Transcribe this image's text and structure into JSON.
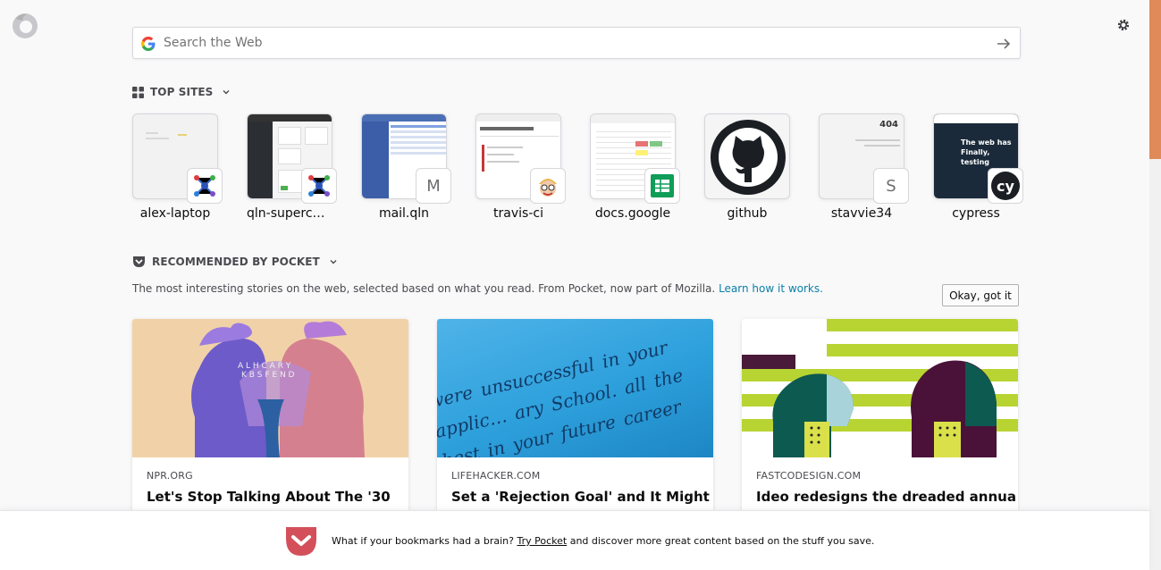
{
  "search": {
    "placeholder": "Search the Web"
  },
  "top_sites": {
    "title": "TOP SITES",
    "tiles": [
      {
        "label": "alex-laptop",
        "badge": "",
        "icon": "network-graph-icon"
      },
      {
        "label": "qln-superca…",
        "badge": "",
        "icon": "network-graph-icon"
      },
      {
        "label": "mail.qln",
        "badge": "M",
        "icon": "letter-m-icon"
      },
      {
        "label": "travis-ci",
        "badge": "",
        "icon": "travis-mascot-icon"
      },
      {
        "label": "docs.google",
        "badge": "",
        "icon": "google-sheets-icon"
      },
      {
        "label": "github",
        "badge": "",
        "icon": "github-octocat-icon"
      },
      {
        "label": "stavvie34",
        "badge": "S",
        "icon": "letter-s-icon"
      },
      {
        "label": "cypress",
        "badge": "cy",
        "icon": "cypress-logo-icon"
      }
    ],
    "cypress_thumb_text": "The web has Finally, testing",
    "stavvie_thumb_text": "404"
  },
  "pocket": {
    "title": "RECOMMENDED BY POCKET",
    "description": "The most interesting stories on the web, selected based on what you read. From Pocket, now part of Mozilla.",
    "learn_link": "Learn how it works.",
    "okay_button": "Okay, got it",
    "cards": [
      {
        "source": "NPR.ORG",
        "headline": "Let's Stop Talking About The '30"
      },
      {
        "source": "LIFEHACKER.COM",
        "headline": "Set a 'Rejection Goal' and It Might",
        "image_text": "were unsuccessful in your applic… ary School. all the best in your future career"
      },
      {
        "source": "FASTCODESIGN.COM",
        "headline": "Ideo redesigns the dreaded annual"
      }
    ]
  },
  "footer": {
    "pre": "What if your bookmarks had a brain?",
    "link": "Try Pocket",
    "post": "and discover more great content based on the stuff you save."
  },
  "colors": {
    "pocket_red": "#d3505a",
    "link": "#0a7fa8",
    "scroll_thumb": "#e08a5a"
  }
}
